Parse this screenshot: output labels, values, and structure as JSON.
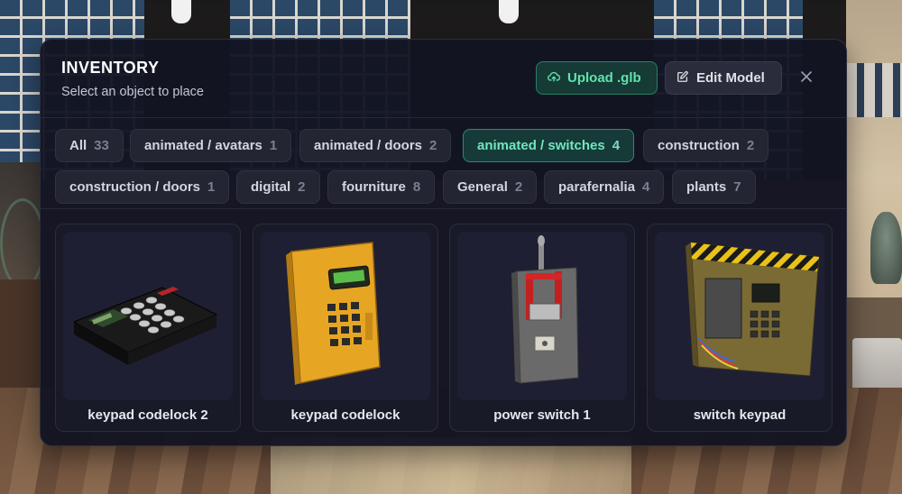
{
  "inventory": {
    "title": "INVENTORY",
    "subtitle": "Select an object to place",
    "upload_label": "Upload .glb",
    "edit_label": "Edit Model",
    "close_icon": "close-icon"
  },
  "filters": [
    {
      "label": "All",
      "count": "33",
      "active": false
    },
    {
      "label": "animated / avatars",
      "count": "1",
      "active": false
    },
    {
      "label": "animated / doors",
      "count": "2",
      "active": false
    },
    {
      "label": "animated / switches",
      "count": "4",
      "active": true
    },
    {
      "label": "construction",
      "count": "2",
      "active": false
    },
    {
      "label": "construction / doors",
      "count": "1",
      "active": false
    },
    {
      "label": "digital",
      "count": "2",
      "active": false
    },
    {
      "label": "fourniture",
      "count": "8",
      "active": false
    },
    {
      "label": "General",
      "count": "2",
      "active": false
    },
    {
      "label": "parafernalia",
      "count": "4",
      "active": false
    },
    {
      "label": "plants",
      "count": "7",
      "active": false
    }
  ],
  "items": [
    {
      "label": "keypad codelock 2",
      "thumbnail": "black-keypad-model"
    },
    {
      "label": "keypad codelock",
      "thumbnail": "yellow-keypad-model"
    },
    {
      "label": "power switch 1",
      "thumbnail": "lever-switch-model"
    },
    {
      "label": "switch keypad",
      "thumbnail": "hazard-keypad-model"
    }
  ],
  "colors": {
    "panel_bg": "#131422",
    "accent_green": "#5fe3ad",
    "chip_bg": "#232533",
    "active_chip_bg": "#163a38"
  }
}
